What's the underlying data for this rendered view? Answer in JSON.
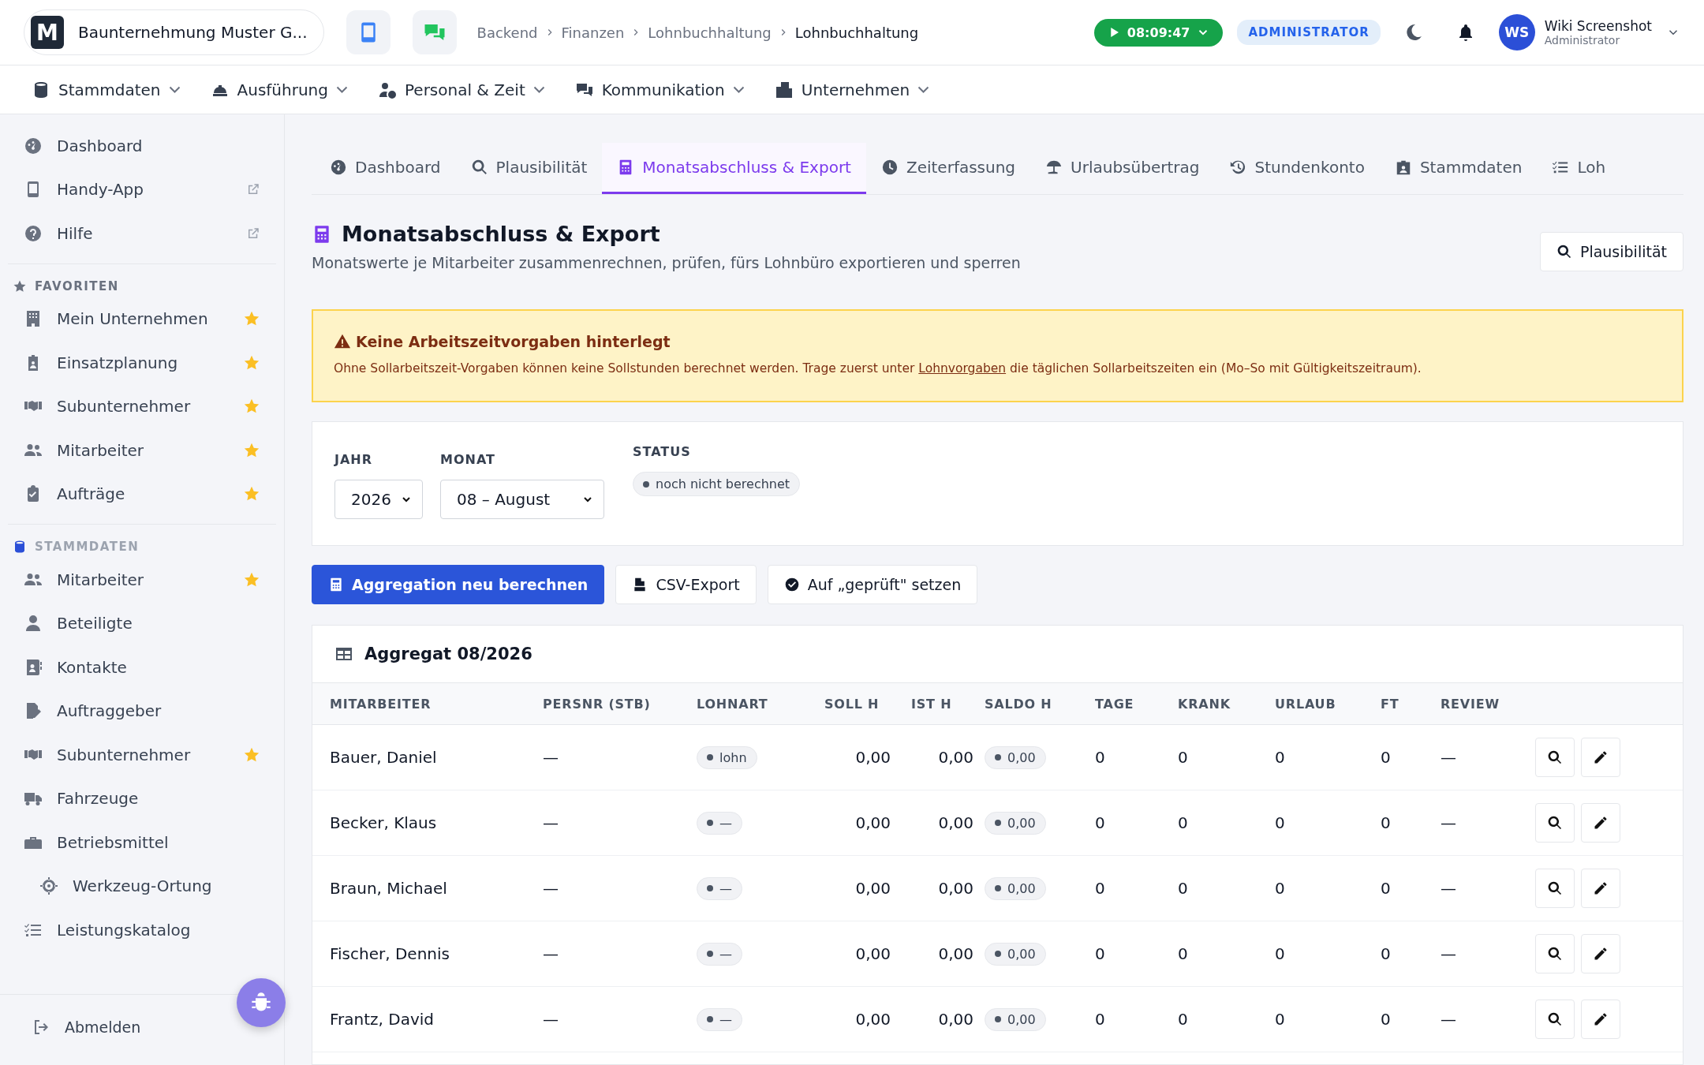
{
  "header": {
    "company": "Baunternehmung Muster G...",
    "logo_letter": "M",
    "breadcrumbs": [
      {
        "label": "Backend",
        "current": false
      },
      {
        "label": "Finanzen",
        "current": false
      },
      {
        "label": "Lohnbuchhaltung",
        "current": false
      },
      {
        "label": "Lohnbuchhaltung",
        "current": true
      }
    ],
    "timer": "08:09:47",
    "role_badge": "ADMINISTRATOR",
    "user": {
      "initials": "WS",
      "name": "Wiki Screenshot",
      "role": "Administrator"
    }
  },
  "top_nav": [
    {
      "label": "Stammdaten"
    },
    {
      "label": "Ausführung"
    },
    {
      "label": "Personal & Zeit"
    },
    {
      "label": "Kommunikation"
    },
    {
      "label": "Unternehmen"
    }
  ],
  "sidebar": {
    "top_items": [
      {
        "label": "Dashboard",
        "external": false
      },
      {
        "label": "Handy-App",
        "external": true
      },
      {
        "label": "Hilfe",
        "external": true
      }
    ],
    "sections": [
      {
        "title": "FAVORITEN",
        "kind": "favorites",
        "items": [
          {
            "label": "Mein Unternehmen",
            "favorite": true
          },
          {
            "label": "Einsatzplanung",
            "favorite": true
          },
          {
            "label": "Subunternehmer",
            "favorite": true
          },
          {
            "label": "Mitarbeiter",
            "favorite": true
          },
          {
            "label": "Aufträge",
            "favorite": true
          }
        ]
      },
      {
        "title": "STAMMDATEN",
        "kind": "database",
        "items": [
          {
            "label": "Mitarbeiter",
            "favorite": true
          },
          {
            "label": "Beteiligte",
            "favorite": false
          },
          {
            "label": "Kontakte",
            "favorite": false
          },
          {
            "label": "Auftraggeber",
            "favorite": false
          },
          {
            "label": "Subunternehmer",
            "favorite": true
          },
          {
            "label": "Fahrzeuge",
            "favorite": false
          },
          {
            "label": "Betriebsmittel",
            "favorite": false,
            "children": [
              {
                "label": "Werkzeug-Ortung",
                "favorite": false
              }
            ]
          },
          {
            "label": "Leistungskatalog",
            "favorite": false
          }
        ]
      }
    ],
    "footer": "Abmelden"
  },
  "tabs": [
    {
      "label": "Dashboard",
      "selected": false
    },
    {
      "label": "Plausibilität",
      "selected": false
    },
    {
      "label": "Monatsabschluss & Export",
      "selected": true
    },
    {
      "label": "Zeiterfassung",
      "selected": false
    },
    {
      "label": "Urlaubsübertrag",
      "selected": false
    },
    {
      "label": "Stundenkonto",
      "selected": false
    },
    {
      "label": "Stammdaten",
      "selected": false
    },
    {
      "label": "Loh",
      "selected": false
    }
  ],
  "page": {
    "title": "Monatsabschluss & Export",
    "subtitle": "Monatswerte je Mitarbeiter zusammenrechnen, prüfen, fürs Lohnbüro exportieren und sperren",
    "action": "Plausibilität"
  },
  "alert": {
    "title": "Keine Arbeitszeitvorgaben hinterlegt",
    "text_before": "Ohne Sollarbeitszeit-Vorgaben können keine Sollstunden berechnet werden. Trage zuerst unter",
    "link": "Lohnvorgaben",
    "text_after": "die täglichen Sollarbeitszeiten ein (Mo–So mit Gültigkeitszeitraum)."
  },
  "filters": {
    "year": {
      "label": "JAHR",
      "value": "2026"
    },
    "month": {
      "label": "MONAT",
      "value": "08 – August"
    },
    "status": {
      "label": "STATUS",
      "value": "noch nicht berechnet"
    }
  },
  "actions": [
    {
      "label": "Aggregation neu berechnen",
      "kind": "primary"
    },
    {
      "label": "CSV-Export",
      "kind": "default"
    },
    {
      "label": "Auf „geprüft\" setzen",
      "kind": "default"
    }
  ],
  "table": {
    "title": "Aggregat 08/2026",
    "columns": [
      "MITARBEITER",
      "PERSNR (STB)",
      "LOHNART",
      "SOLL H",
      "IST H",
      "SALDO H",
      "TAGE",
      "KRANK",
      "URLAUB",
      "FT",
      "REVIEW"
    ],
    "rows": [
      {
        "name": "Bauer, Daniel",
        "persnr": "—",
        "lohnart": "lohn",
        "soll": "0,00",
        "ist": "0,00",
        "saldo": "0,00",
        "tage": "0",
        "krank": "0",
        "urlaub": "0",
        "ft": "0",
        "review": "—"
      },
      {
        "name": "Becker, Klaus",
        "persnr": "—",
        "lohnart": "—",
        "soll": "0,00",
        "ist": "0,00",
        "saldo": "0,00",
        "tage": "0",
        "krank": "0",
        "urlaub": "0",
        "ft": "0",
        "review": "—"
      },
      {
        "name": "Braun, Michael",
        "persnr": "—",
        "lohnart": "—",
        "soll": "0,00",
        "ist": "0,00",
        "saldo": "0,00",
        "tage": "0",
        "krank": "0",
        "urlaub": "0",
        "ft": "0",
        "review": "—"
      },
      {
        "name": "Fischer, Dennis",
        "persnr": "—",
        "lohnart": "—",
        "soll": "0,00",
        "ist": "0,00",
        "saldo": "0,00",
        "tage": "0",
        "krank": "0",
        "urlaub": "0",
        "ft": "0",
        "review": "—"
      },
      {
        "name": "Frantz, David",
        "persnr": "—",
        "lohnart": "—",
        "soll": "0,00",
        "ist": "0,00",
        "saldo": "0,00",
        "tage": "0",
        "krank": "0",
        "urlaub": "0",
        "ft": "0",
        "review": "—"
      }
    ]
  }
}
